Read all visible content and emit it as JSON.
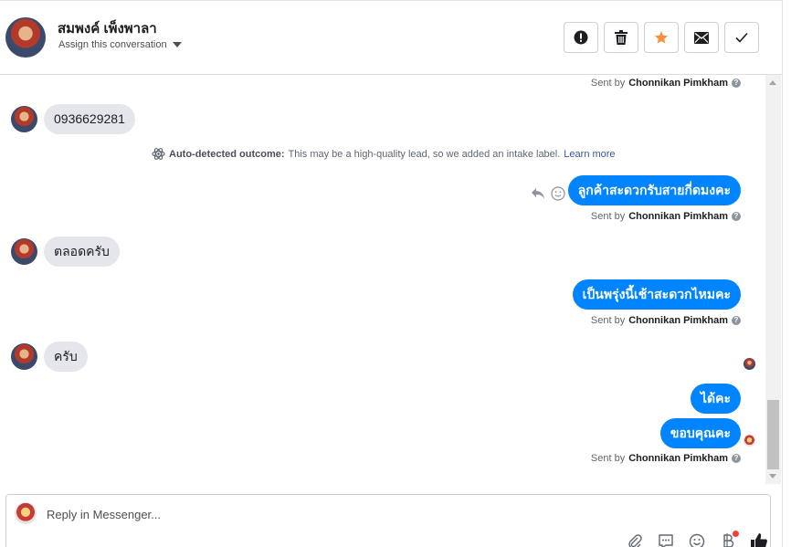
{
  "header": {
    "contact_name": "สมพงค์ เพ็งพาลา",
    "assign_label": "Assign this conversation",
    "actions": [
      "spam-icon",
      "trash-icon",
      "star-icon",
      "envelope-icon",
      "check-icon"
    ]
  },
  "messages": {
    "sent_by_prefix": "Sent by",
    "sent_by_name": "Chonnikan Pimkham",
    "incoming_1": "0936629281",
    "outcome_label": "Auto-detected outcome:",
    "outcome_text": "This may be a high-quality lead, so we added an intake label.",
    "outcome_link": "Learn more",
    "outgoing_1": "ลูกค้าสะดวกรับสายกี่ดมงคะ",
    "incoming_2": "ตลอดครับ",
    "outgoing_2": "เป็นพรุ่งนี้เช้าสะดวกไหมคะ",
    "incoming_3": "ครับ",
    "outgoing_3": "ได้คะ",
    "outgoing_4": "ขอบคุณคะ"
  },
  "composer": {
    "placeholder": "Reply in Messenger..."
  },
  "colors": {
    "accent": "#0084ff",
    "bubble_in": "#e4e6eb",
    "star": "#f7923a"
  }
}
